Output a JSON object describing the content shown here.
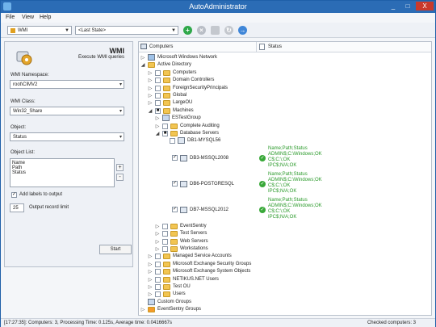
{
  "title": "AutoAdministrator",
  "window_controls": {
    "minimize": "_",
    "maximize": "□",
    "close": "X"
  },
  "menu": [
    "File",
    "View",
    "Help"
  ],
  "toolbar": {
    "module_select": "WMI",
    "state_select": "<Last State>"
  },
  "left": {
    "heading": "WMI",
    "subheading": "Execute WMI queries",
    "namespace_label": "WMI Namespace:",
    "namespace_value": "root\\CIMV2",
    "class_label": "WMI Class:",
    "class_value": "Win32_Share",
    "object_label": "Object:",
    "object_value": "Status",
    "objectlist_label": "Object List:",
    "objectlist": [
      "Name",
      "Path",
      "Status"
    ],
    "add_labels": "Add labels to output",
    "limit_value": "25",
    "limit_label": "Output record limit",
    "start": "Start"
  },
  "tree": {
    "col_computers": "Computers",
    "col_status": "Status",
    "rows": [
      {
        "text": "Microsoft Windows Network",
        "level": 0,
        "exp": "▷",
        "cb": false,
        "icon": "net"
      },
      {
        "text": "Active Directory",
        "level": 0,
        "exp": "◢",
        "cb": false,
        "icon": "folder"
      },
      {
        "text": "Computers",
        "level": 1,
        "exp": "▷",
        "cb": true,
        "check": "",
        "icon": "folder"
      },
      {
        "text": "Domain Controllers",
        "level": 1,
        "exp": "▷",
        "cb": true,
        "check": "",
        "icon": "folder"
      },
      {
        "text": "ForeignSecurityPrincipals",
        "level": 1,
        "exp": "▷",
        "cb": true,
        "check": "",
        "icon": "folder"
      },
      {
        "text": "Global",
        "level": 1,
        "exp": "▷",
        "cb": true,
        "check": "",
        "icon": "folder"
      },
      {
        "text": "LargeOU",
        "level": 1,
        "exp": "▷",
        "cb": true,
        "check": "",
        "icon": "folder"
      },
      {
        "text": "Machines",
        "level": 1,
        "exp": "◢",
        "cb": true,
        "check": "■",
        "icon": "folder"
      },
      {
        "text": "ESTestGroup",
        "level": 2,
        "exp": "▷",
        "cb": false,
        "icon": "group"
      },
      {
        "text": "Complete Auditing",
        "level": 2,
        "exp": "▷",
        "cb": true,
        "check": "",
        "icon": "folder"
      },
      {
        "text": "Database Servers",
        "level": 2,
        "exp": "◢",
        "cb": true,
        "check": "■",
        "icon": "folder"
      },
      {
        "text": "DB1-MYSQL56",
        "level": 3,
        "exp": "",
        "cb": true,
        "check": "",
        "icon": "pc"
      }
    ],
    "servers": [
      {
        "text": "DB3-MSSQL2008",
        "status": [
          "Name;Path;Status",
          "ADMIN$;C:\\Windows;OK",
          "C$;C:\\;OK",
          "IPC$;N/A;OK"
        ]
      },
      {
        "text": "DB6-POSTGRESQL",
        "status": [
          "Name;Path;Status",
          "ADMIN$;C:\\Windows;OK",
          "C$;C:\\;OK",
          "IPC$;N/A;OK"
        ]
      },
      {
        "text": "DB7-MSSQL2012",
        "status": [
          "Name;Path;Status",
          "ADMIN$;C:\\Windows;OK",
          "C$;C:\\;OK",
          "IPC$;N/A;OK"
        ]
      }
    ],
    "rows_after": [
      {
        "text": "EventSentry",
        "level": 2,
        "exp": "▷",
        "cb": true,
        "icon": "folder"
      },
      {
        "text": "Test Servers",
        "level": 2,
        "exp": "▷",
        "cb": true,
        "icon": "folder"
      },
      {
        "text": "Web Servers",
        "level": 2,
        "exp": "▷",
        "cb": true,
        "icon": "folder"
      },
      {
        "text": "Workstations",
        "level": 2,
        "exp": "▷",
        "cb": true,
        "icon": "folder"
      },
      {
        "text": "Managed Service Accounts",
        "level": 1,
        "exp": "▷",
        "cb": true,
        "icon": "folder"
      },
      {
        "text": "Microsoft Exchange Security Groups",
        "level": 1,
        "exp": "▷",
        "cb": true,
        "icon": "folder"
      },
      {
        "text": "Microsoft Exchange System Objects",
        "level": 1,
        "exp": "▷",
        "cb": true,
        "icon": "folder"
      },
      {
        "text": "NETIKUS.NET Users",
        "level": 1,
        "exp": "▷",
        "cb": true,
        "icon": "folder"
      },
      {
        "text": "Test OU",
        "level": 1,
        "exp": "▷",
        "cb": true,
        "icon": "folder"
      },
      {
        "text": "Users",
        "level": 1,
        "exp": "▷",
        "cb": true,
        "icon": "folder"
      },
      {
        "text": "Custom Groups",
        "level": 0,
        "exp": "",
        "cb": false,
        "icon": "group"
      },
      {
        "text": "EventSentry Groups",
        "level": 0,
        "exp": "▷",
        "cb": false,
        "icon": "es"
      }
    ]
  },
  "statusbar": {
    "left": "[17:27:35]: Computers: 3, Processing Time: 0.125s, Average time: 0.0416667s",
    "right": "Checked computers: 3"
  }
}
